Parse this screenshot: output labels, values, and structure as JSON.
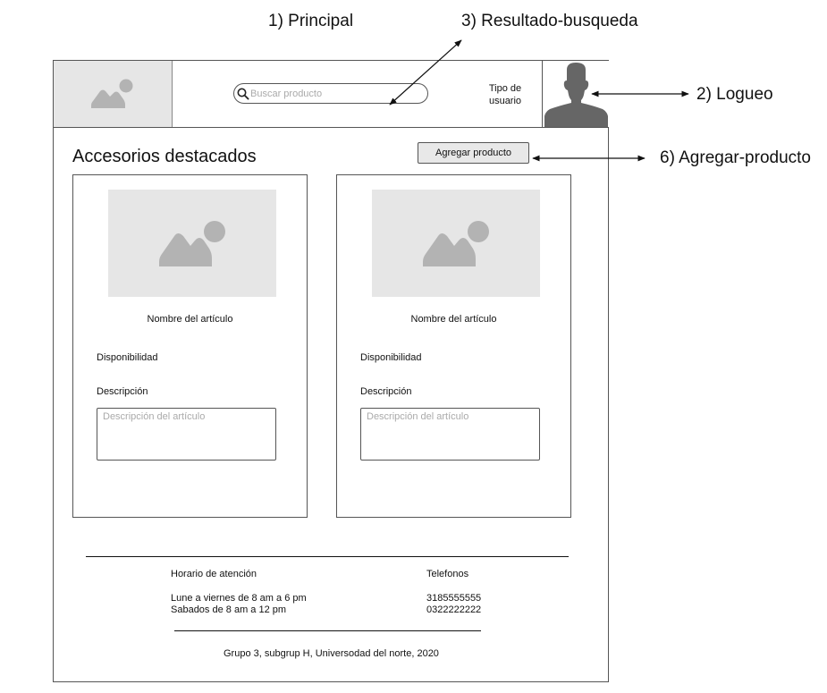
{
  "annotations": {
    "principal": "1) Principal",
    "resultado": "3) Resultado-busqueda",
    "logueo": "2) Logueo",
    "agregar": "6) Agregar-producto"
  },
  "header": {
    "search_placeholder": "Buscar producto",
    "user_type_line1": "Tipo de",
    "user_type_line2": "usuario"
  },
  "main": {
    "title": "Accesorios destacados",
    "add_button": "Agregar producto",
    "cards": [
      {
        "name": "Nombre del artículo",
        "availability": "Disponibilidad",
        "description_label": "Descripción",
        "description_placeholder": "Descripción del artículo"
      },
      {
        "name": "Nombre del artículo",
        "availability": "Disponibilidad",
        "description_label": "Descripción",
        "description_placeholder": "Descripción del artículo"
      }
    ]
  },
  "footer": {
    "hours_title": "Horario de atención",
    "hours_line1": "Lune a viernes de 8 am a 6 pm",
    "hours_line2": "Sabados de 8 am a 12 pm",
    "phones_title": "Telefonos",
    "phone1": "3185555555",
    "phone2": "0322222222",
    "credits": "Grupo 3, subgrup H, Universodad del norte, 2020"
  },
  "icons": {
    "logo": "image-placeholder-icon",
    "search": "search-icon",
    "avatar": "user-silhouette-icon",
    "card_image": "image-placeholder-icon"
  },
  "colors": {
    "placeholder_fill": "#e6e6e6",
    "icon_gray": "#b3b3b3",
    "avatar_gray": "#666666",
    "button_fill": "#e8e8e8"
  }
}
